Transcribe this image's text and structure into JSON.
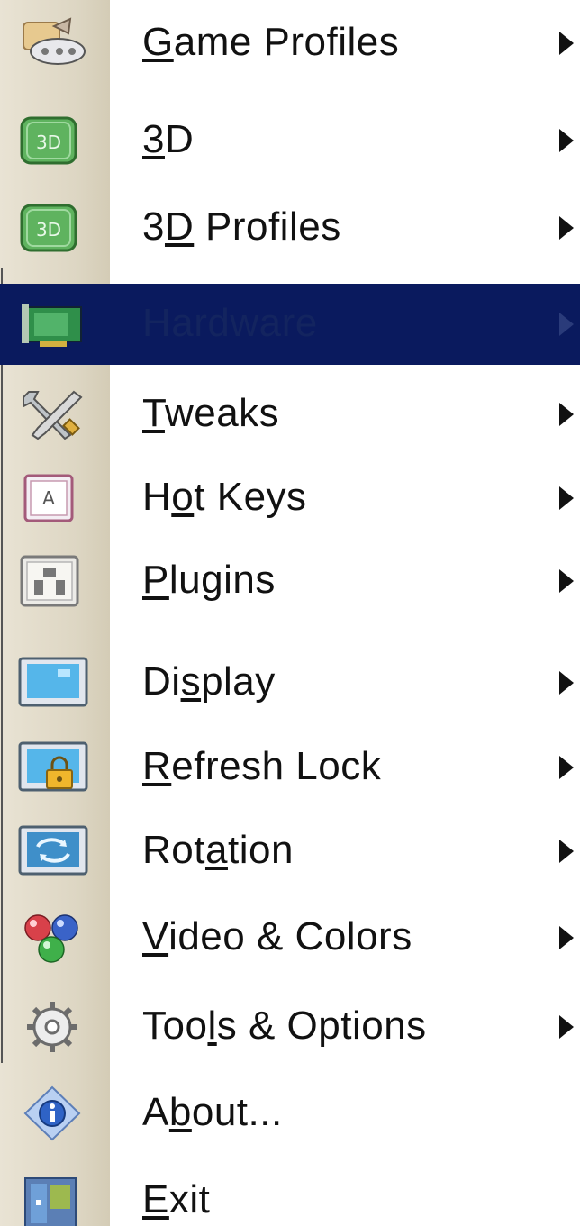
{
  "menu": {
    "items": [
      {
        "label_pre": "",
        "accel": "G",
        "label_post": "ame Profiles",
        "icon": "game-profiles-icon",
        "has_submenu": true
      },
      {
        "label_pre": "",
        "accel": "3",
        "label_post": "D",
        "icon": "3d-icon",
        "has_submenu": true
      },
      {
        "label_pre": "3",
        "accel": "D",
        "label_post": " Profiles",
        "icon": "3d-profiles-icon",
        "has_submenu": true
      },
      {
        "label_pre": "Hardware",
        "accel": "",
        "label_post": "",
        "icon": "graphics-card-icon",
        "has_submenu": true,
        "selected": true
      },
      {
        "label_pre": "",
        "accel": "T",
        "label_post": "weaks",
        "icon": "tools-wrench-icon",
        "has_submenu": true
      },
      {
        "label_pre": "H",
        "accel": "o",
        "label_post": "t Keys",
        "icon": "hotkey-icon",
        "has_submenu": true
      },
      {
        "label_pre": "",
        "accel": "P",
        "label_post": "lugins",
        "icon": "plugin-icon",
        "has_submenu": true
      },
      {
        "label_pre": "Di",
        "accel": "s",
        "label_post": "play",
        "icon": "monitor-icon",
        "has_submenu": true
      },
      {
        "label_pre": "",
        "accel": "R",
        "label_post": "efresh Lock",
        "icon": "refresh-lock-icon",
        "has_submenu": true
      },
      {
        "label_pre": "Rot",
        "accel": "a",
        "label_post": "tion",
        "icon": "rotation-icon",
        "has_submenu": true
      },
      {
        "label_pre": "",
        "accel": "V",
        "label_post": "ideo & Colors",
        "icon": "color-balls-icon",
        "has_submenu": true
      },
      {
        "label_pre": "Too",
        "accel": "l",
        "label_post": "s & Options",
        "icon": "gear-icon",
        "has_submenu": true
      },
      {
        "label_pre": "A",
        "accel": "b",
        "label_post": "out...",
        "icon": "info-icon",
        "has_submenu": false
      },
      {
        "label_pre": "",
        "accel": "E",
        "label_post": "xit",
        "icon": "exit-icon",
        "has_submenu": false
      }
    ]
  },
  "colors": {
    "highlight": "#0a1a5e",
    "gutter": "#ddd6c3",
    "text": "#111111",
    "green_badge": "#5fb35f"
  }
}
